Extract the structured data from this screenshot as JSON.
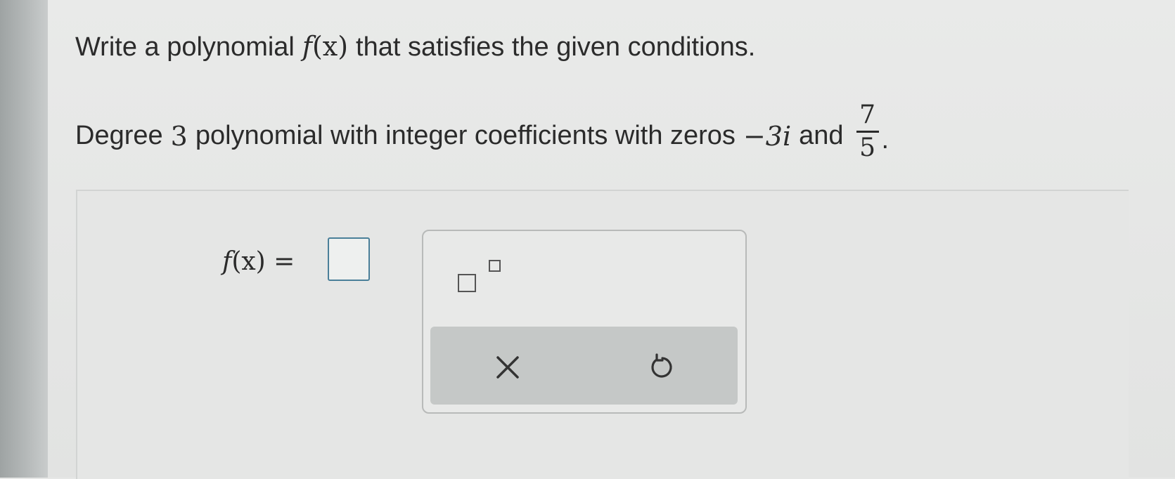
{
  "question": {
    "prompt_pre": "Write a polynomial",
    "fn_f": "f",
    "fn_paren": "(x)",
    "prompt_post": "that satisfies the given conditions.",
    "cond_pre": "Degree",
    "degree": "3",
    "cond_mid": "polynomial with integer coefficients with zeros",
    "zero_1": "−3i",
    "cond_and": "and",
    "zero_2_num": "7",
    "zero_2_den": "5",
    "cond_end": "."
  },
  "answer": {
    "lhs_f": "f",
    "lhs_rest": "(x) ="
  },
  "icons": {
    "exponent": "superscript-template-icon",
    "clear": "x-icon",
    "undo": "undo-icon"
  },
  "colors": {
    "input_border": "#4a7f99",
    "action_bar": "#c5c8c7",
    "text": "#2b2b2b"
  }
}
